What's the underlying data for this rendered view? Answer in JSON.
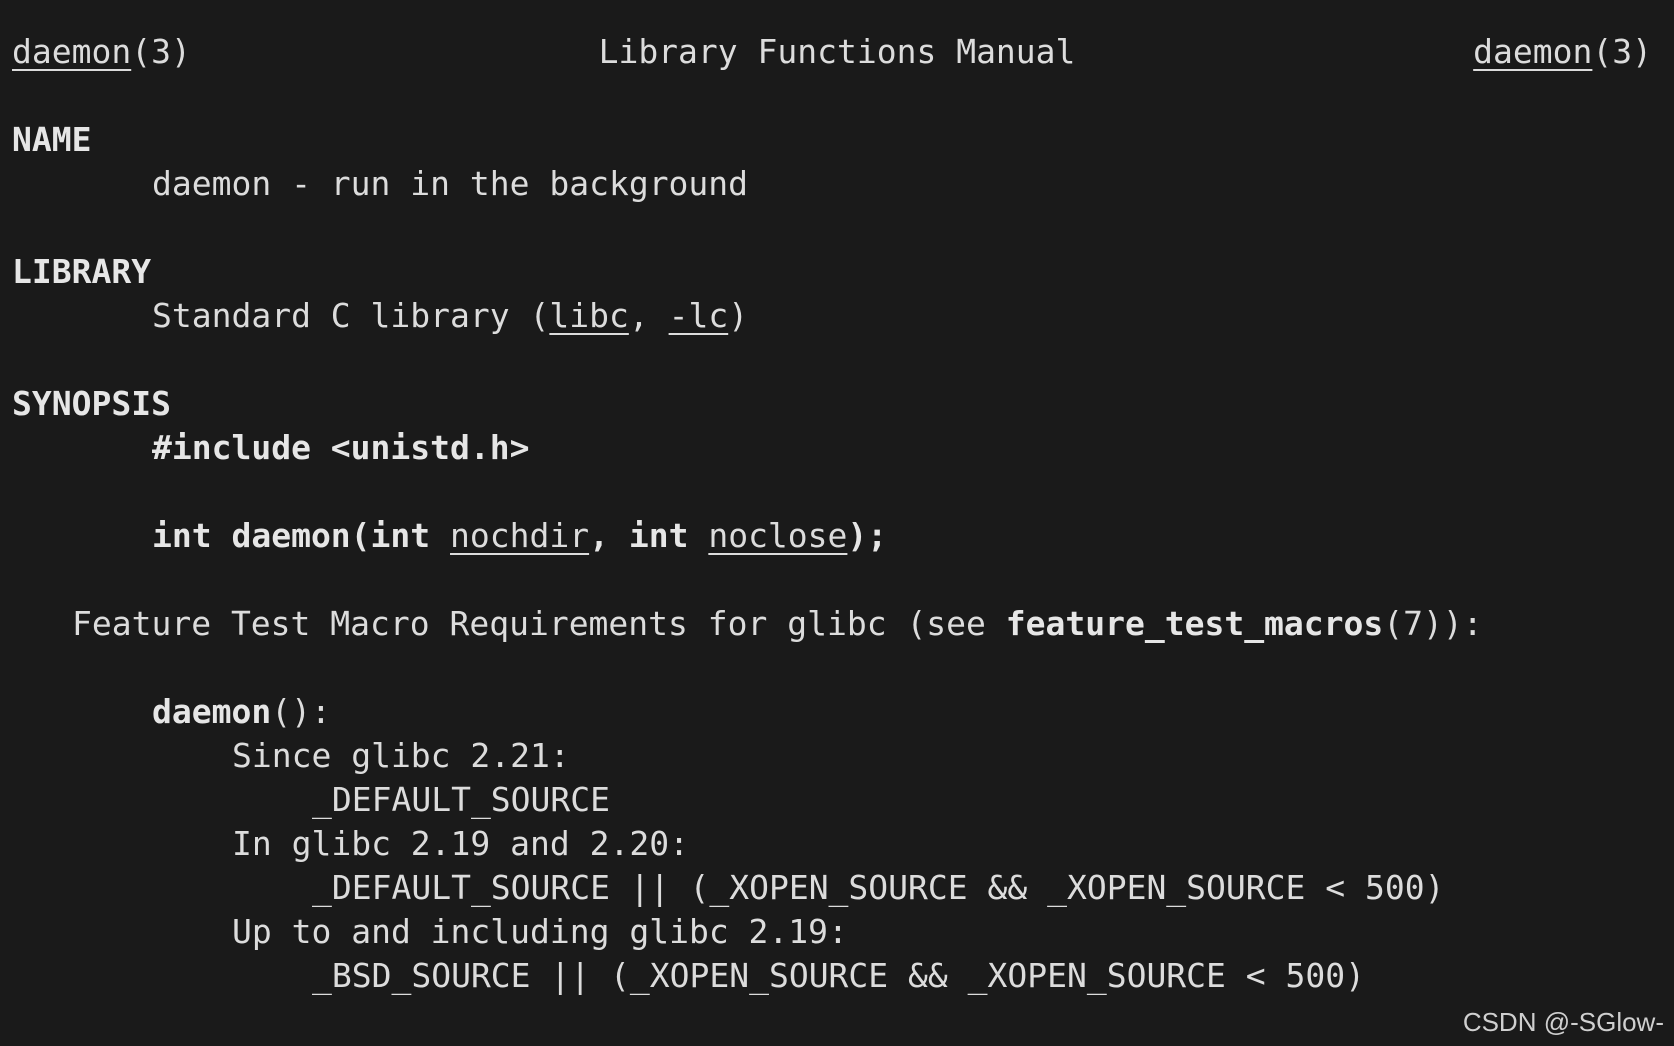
{
  "header": {
    "left_name": "daemon",
    "left_section": "(3)",
    "title": "Library Functions Manual",
    "right_name": "daemon",
    "right_section": "(3)"
  },
  "name_section": {
    "heading": "NAME",
    "text": "daemon - run in the background"
  },
  "library_section": {
    "heading": "LIBRARY",
    "prefix": "Standard C library (",
    "lib1": "libc",
    "sep": ", ",
    "lib2": "-lc",
    "suffix": ")"
  },
  "synopsis_section": {
    "heading": "SYNOPSIS",
    "include": "#include <unistd.h>",
    "proto_ret": "int daemon(int ",
    "param1": "nochdir",
    "proto_mid_sep": ", ",
    "proto_mid_int": "int",
    "proto_mid_space": " ",
    "param2": "noclose",
    "proto_end": ");"
  },
  "ftm": {
    "prefix": "Feature Test Macro Requirements for glibc (see ",
    "ref_name": "feature_test_macros",
    "ref_suffix": "(7)):",
    "func_name": "daemon",
    "func_suffix": "():",
    "lines": [
      "Since glibc 2.21:",
      "_DEFAULT_SOURCE",
      "In glibc 2.19 and 2.20:",
      "_DEFAULT_SOURCE || (_XOPEN_SOURCE && _XOPEN_SOURCE < 500)",
      "Up to and including glibc 2.19:",
      "_BSD_SOURCE || (_XOPEN_SOURCE && _XOPEN_SOURCE < 500)"
    ]
  },
  "watermark": "CSDN @-SGlow-"
}
